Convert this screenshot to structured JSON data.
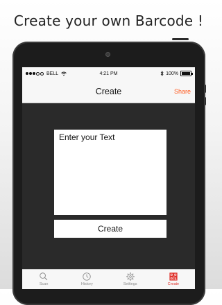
{
  "headline": "Create your own Barcode !",
  "status_bar": {
    "carrier": "BELL",
    "time": "4:21 PM",
    "battery": "100%"
  },
  "nav": {
    "title": "Create",
    "share": "Share"
  },
  "form": {
    "placeholder": "Enter your Text",
    "create_button": "Create"
  },
  "tabs": [
    {
      "label": "Scan",
      "icon": "magnifier-icon"
    },
    {
      "label": "History",
      "icon": "clock-icon"
    },
    {
      "label": "Settings",
      "icon": "gear-icon"
    },
    {
      "label": "Create",
      "icon": "qr-code-icon"
    }
  ],
  "colors": {
    "accent": "#ff5a1f",
    "active_tab": "#e0322c",
    "screen_bg": "#2a2a2a"
  }
}
